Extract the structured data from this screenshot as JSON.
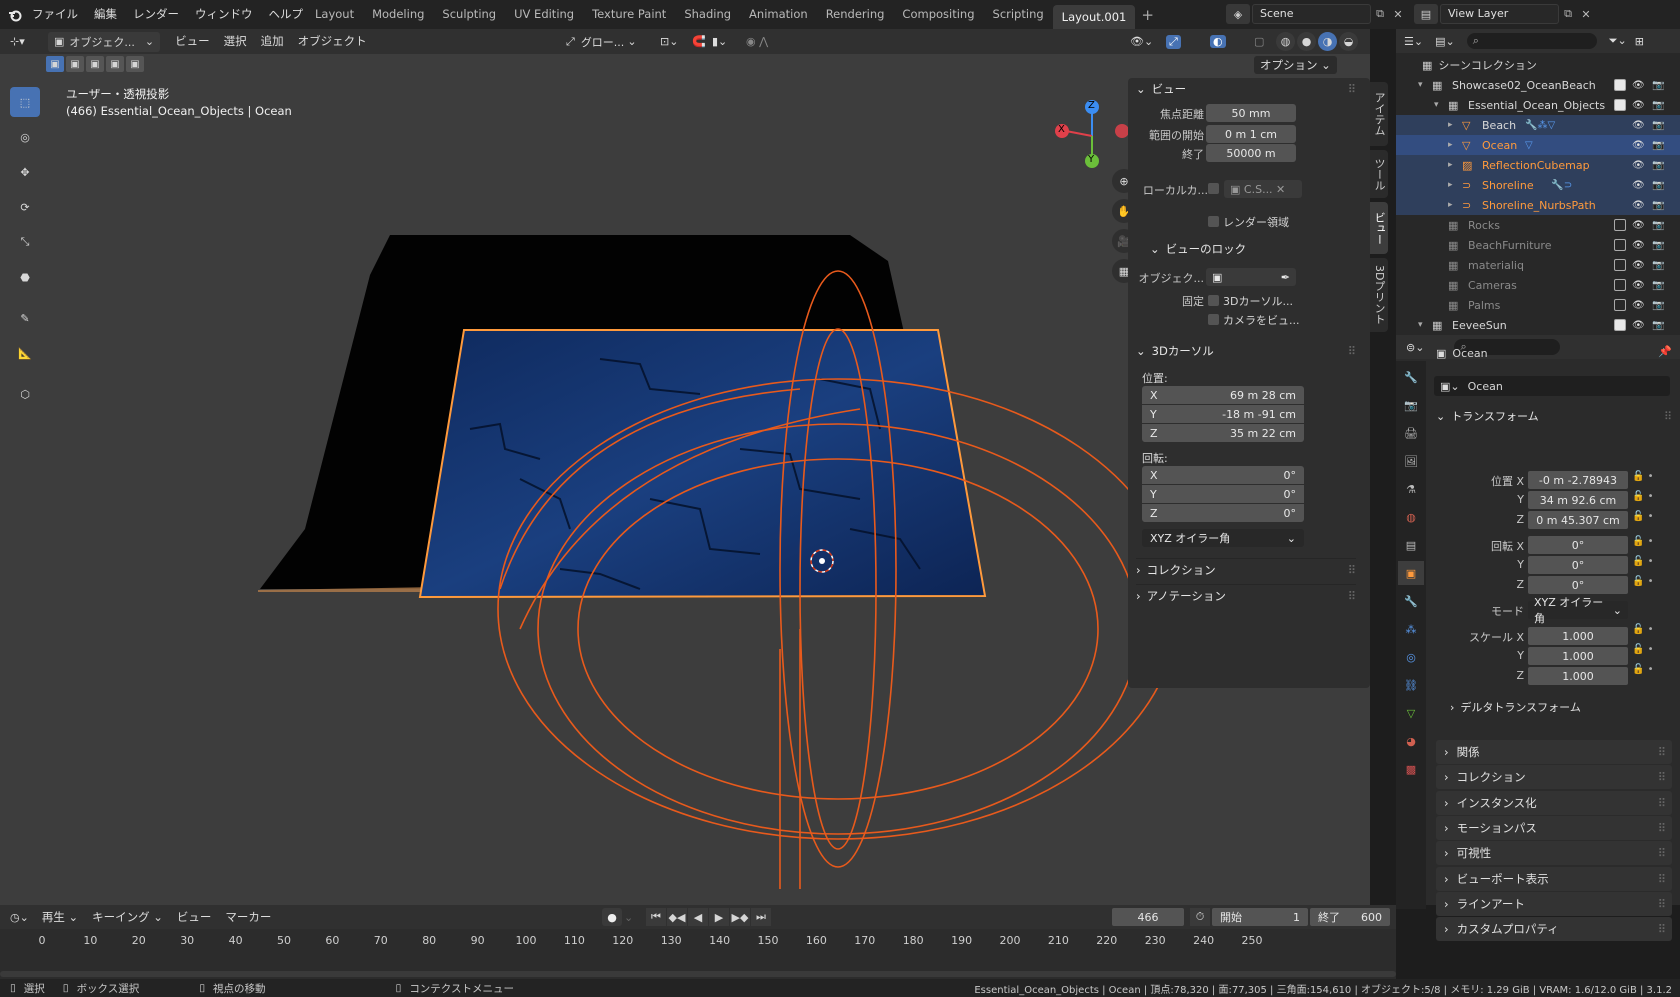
{
  "topbar": {
    "menus": [
      "ファイル",
      "編集",
      "レンダー",
      "ウィンドウ",
      "ヘルプ"
    ],
    "workspaces": [
      "Layout",
      "Modeling",
      "Sculpting",
      "UV Editing",
      "Texture Paint",
      "Shading",
      "Animation",
      "Rendering",
      "Compositing",
      "Scripting",
      "Layout.001"
    ],
    "active_workspace": "Layout.001",
    "scene": "Scene",
    "view_layer": "View Layer"
  },
  "viewport_header": {
    "mode": "オブジェク...",
    "menus": [
      "ビュー",
      "選択",
      "追加",
      "オブジェクト"
    ],
    "orientation": "グロー...",
    "options": "オプション"
  },
  "viewport": {
    "view_name": "ユーザー・透視投影",
    "object_info": "(466) Essential_Ocean_Objects | Ocean",
    "gizmo": {
      "x": "X",
      "y": "Y",
      "z": "Z"
    }
  },
  "npanel": {
    "view_header": "ビュー",
    "focal_label": "焦点距離",
    "focal": "50 mm",
    "clip_start_label": "範囲の開始",
    "clip_start": "0 m 1 cm",
    "clip_end_label": "終了",
    "clip_end": "50000 m",
    "local_camera_label": "ローカルカ...",
    "local_camera_value": "C.S...",
    "render_region": "レンダー領域",
    "view_lock_header": "ビューのロック",
    "lock_object_label": "オブジェク...",
    "lock_label": "固定",
    "lock_cursor": "3Dカーソル...",
    "lock_camera": "カメラをビュ...",
    "cursor_header": "3Dカーソル",
    "location_label": "位置:",
    "cursor_x": "69 m 28 cm",
    "cursor_y": "-18 m -91 cm",
    "cursor_z": "35 m 22 cm",
    "rotation_label": "回転:",
    "rot_x": "0°",
    "rot_y": "0°",
    "rot_z": "0°",
    "rot_mode": "XYZ オイラー角",
    "collection_header": "コレクション",
    "annotation_header": "アノテーション",
    "axis_x": "X",
    "axis_y": "Y",
    "axis_z": "Z"
  },
  "vtabs": [
    "アイテム",
    "ツール",
    "ビュー",
    "3Dプリント"
  ],
  "outliner": {
    "root": "シーンコレクション",
    "rows": [
      {
        "name": "Showcase02_OceanBeach",
        "color": "#d8d8d8"
      },
      {
        "name": "Essential_Ocean_Objects",
        "color": "#d8d8d8"
      },
      {
        "name": "Beach",
        "color": "#d8d8d8"
      },
      {
        "name": "Ocean",
        "color": "#ff9a3c"
      },
      {
        "name": "ReflectionCubemap",
        "color": "#ff9a3c"
      },
      {
        "name": "Shoreline",
        "color": "#ff9a3c"
      },
      {
        "name": "Shoreline_NurbsPath",
        "color": "#ff9a3c"
      },
      {
        "name": "Rocks",
        "color": "#8a8a8a"
      },
      {
        "name": "BeachFurniture",
        "color": "#8a8a8a"
      },
      {
        "name": "materialiq",
        "color": "#8a8a8a"
      },
      {
        "name": "Cameras",
        "color": "#8a8a8a"
      },
      {
        "name": "Palms",
        "color": "#8a8a8a"
      },
      {
        "name": "EeveeSun",
        "color": "#d8d8d8"
      }
    ]
  },
  "properties": {
    "object_name": "Ocean",
    "datablock": "Ocean",
    "transform_header": "トランスフォーム",
    "loc_label": "位置 X",
    "loc_x": "-0 m -2.78943",
    "loc_y": "34 m 92.6 cm",
    "loc_z": "0 m 45.307 cm",
    "rot_label": "回転 X",
    "rot_x": "0°",
    "rot_y": "0°",
    "rot_z": "0°",
    "mode_label": "モード",
    "mode": "XYZ オイラー角",
    "scale_label": "スケール X",
    "scale_x": "1.000",
    "scale_y": "1.000",
    "scale_z": "1.000",
    "label_y": "Y",
    "label_z": "Z",
    "delta": "デルタトランスフォーム",
    "sections": [
      "関係",
      "コレクション",
      "インスタンス化",
      "モーションパス",
      "可視性",
      "ビューポート表示",
      "ラインアート",
      "カスタムプロパティ"
    ]
  },
  "timeline": {
    "menus": [
      "再生",
      "キーイング",
      "ビュー",
      "マーカー"
    ],
    "current_frame": "466",
    "start_label": "開始",
    "start": "1",
    "end_label": "終了",
    "end": "600",
    "ticks": [
      "0",
      "10",
      "20",
      "30",
      "40",
      "50",
      "60",
      "70",
      "80",
      "90",
      "100",
      "110",
      "120",
      "130",
      "140",
      "150",
      "160",
      "170",
      "180",
      "190",
      "200",
      "210",
      "220",
      "230",
      "240",
      "250"
    ]
  },
  "statusbar": {
    "select": "選択",
    "box_select": "ボックス選択",
    "rotate_view": "視点の移動",
    "context_menu": "コンテクストメニュー",
    "stats": "Essential_Ocean_Objects | Ocean | 頂点:78,320 | 面:77,305 | 三角面:154,610 | オブジェクト:5/8 | メモリ: 1.29 GiB | VRAM: 1.6/12.0 GiB | 3.1.2"
  },
  "colors": {
    "accent": "#4772b3",
    "selected_orange": "#ff9a3c",
    "ocean_blue": "#163a78",
    "light_orange": "#e85a1c"
  }
}
